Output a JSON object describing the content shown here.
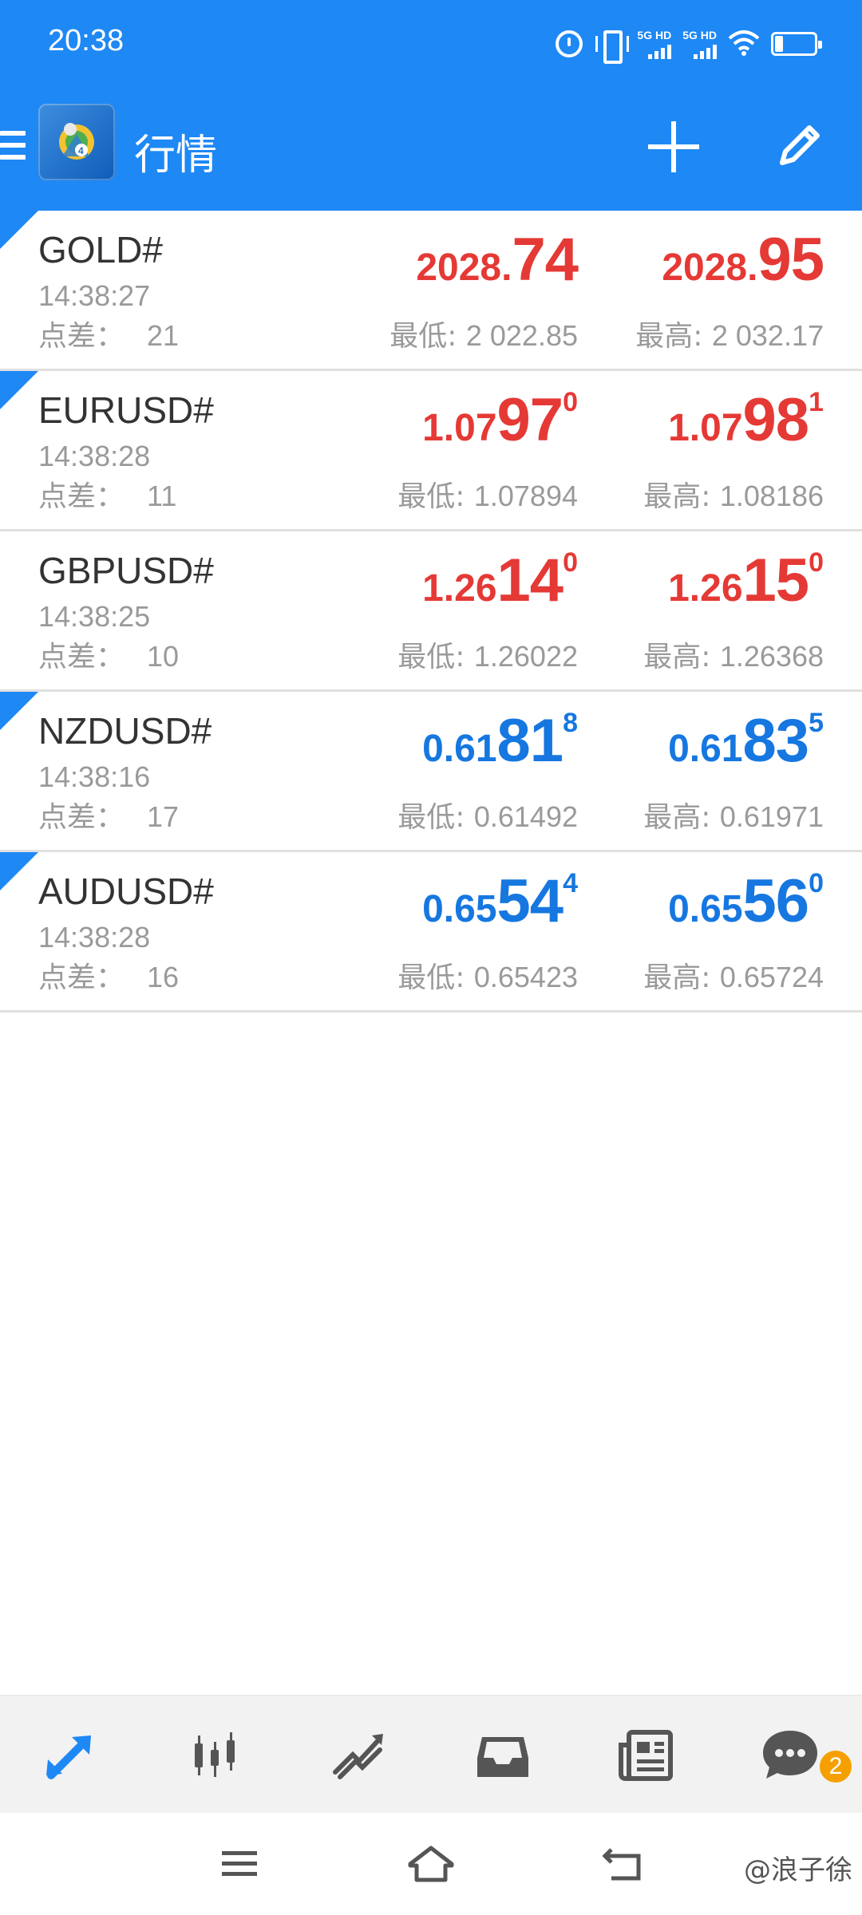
{
  "status_bar": {
    "time": "20:38",
    "signal1_label": "5G HD",
    "signal2_label": "5G HD",
    "battery_level": "20"
  },
  "app_bar": {
    "title": "行情",
    "icons": [
      "menu-icon",
      "metatrader-logo",
      "add-icon",
      "edit-icon"
    ]
  },
  "quotes": [
    {
      "symbol": "GOLD#",
      "time": "14:38:27",
      "spread_label": "点差：",
      "spread": "21",
      "bid_small": "2028.",
      "bid_big": "74",
      "bid_sup": "",
      "ask_small": "2028.",
      "ask_big": "95",
      "ask_sup": "",
      "low_label": "最低: ",
      "low": "2 022.85",
      "high_label": "最高: ",
      "high": "2 032.17",
      "color": "#e53935"
    },
    {
      "symbol": "EURUSD#",
      "time": "14:38:28",
      "spread_label": "点差：",
      "spread": "11",
      "bid_small": "1.07",
      "bid_big": "97",
      "bid_sup": "0",
      "ask_small": "1.07",
      "ask_big": "98",
      "ask_sup": "1",
      "low_label": "最低: ",
      "low": "1.07894",
      "high_label": "最高: ",
      "high": "1.08186",
      "color": "#e53935"
    },
    {
      "symbol": "GBPUSD#",
      "time": "14:38:25",
      "spread_label": "点差：",
      "spread": "10",
      "bid_small": "1.26",
      "bid_big": "14",
      "bid_sup": "0",
      "ask_small": "1.26",
      "ask_big": "15",
      "ask_sup": "0",
      "low_label": "最低: ",
      "low": "1.26022",
      "high_label": "最高: ",
      "high": "1.26368",
      "color": "#e53935"
    },
    {
      "symbol": "NZDUSD#",
      "time": "14:38:16",
      "spread_label": "点差：",
      "spread": "17",
      "bid_small": "0.61",
      "bid_big": "81",
      "bid_sup": "8",
      "ask_small": "0.61",
      "ask_big": "83",
      "ask_sup": "5",
      "low_label": "最低: ",
      "low": "0.61492",
      "high_label": "最高: ",
      "high": "0.61971",
      "color": "#1677e0"
    },
    {
      "symbol": "AUDUSD#",
      "time": "14:38:28",
      "spread_label": "点差：",
      "spread": "16",
      "bid_small": "0.65",
      "bid_big": "54",
      "bid_sup": "4",
      "ask_small": "0.65",
      "ask_big": "56",
      "ask_sup": "0",
      "low_label": "最低: ",
      "low": "0.65423",
      "high_label": "最高: ",
      "high": "0.65724",
      "color": "#1677e0"
    }
  ],
  "bottom_nav": {
    "items": [
      "quotes-icon",
      "chart-icon",
      "trade-icon",
      "history-icon",
      "news-icon",
      "chat-icon"
    ],
    "active": "quotes-icon",
    "chat_badge": "2",
    "active_color": "#1e88f5",
    "inactive_color": "#555555"
  },
  "system_nav": {
    "items": [
      "recents-icon",
      "home-icon",
      "back-icon"
    ],
    "watermark": "@浪子徐"
  }
}
